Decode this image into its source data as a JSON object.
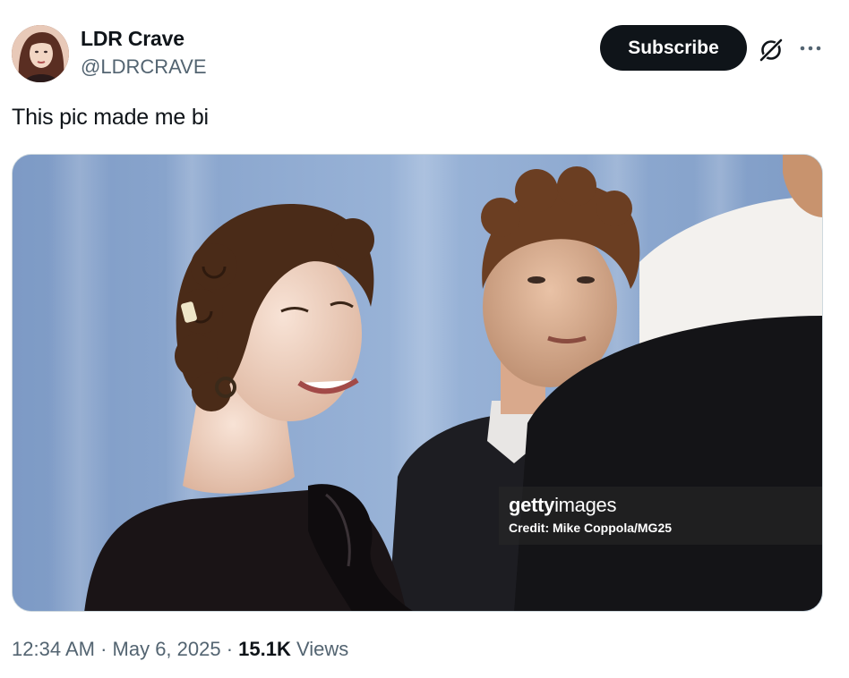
{
  "author": {
    "display_name": "LDR Crave",
    "handle": "@LDRCRAVE",
    "avatar_icon": "profile-photo"
  },
  "actions": {
    "subscribe_label": "Subscribe",
    "grok_icon": "grok-icon",
    "more_icon": "more-dots-icon"
  },
  "tweet": {
    "text": "This pic made me bi"
  },
  "media": {
    "watermark_brand_bold": "getty",
    "watermark_brand_light": "images",
    "watermark_credit": "Credit: Mike Coppola/MG25"
  },
  "meta": {
    "time": "12:34 AM",
    "separator": " · ",
    "date": "May 6, 2025",
    "views_count": "15.1K",
    "views_label": " Views"
  },
  "colors": {
    "primary_text": "#0f1419",
    "secondary_text": "#536471",
    "button_bg": "#0f1419",
    "backdrop_blue": "#8aa6cf"
  }
}
